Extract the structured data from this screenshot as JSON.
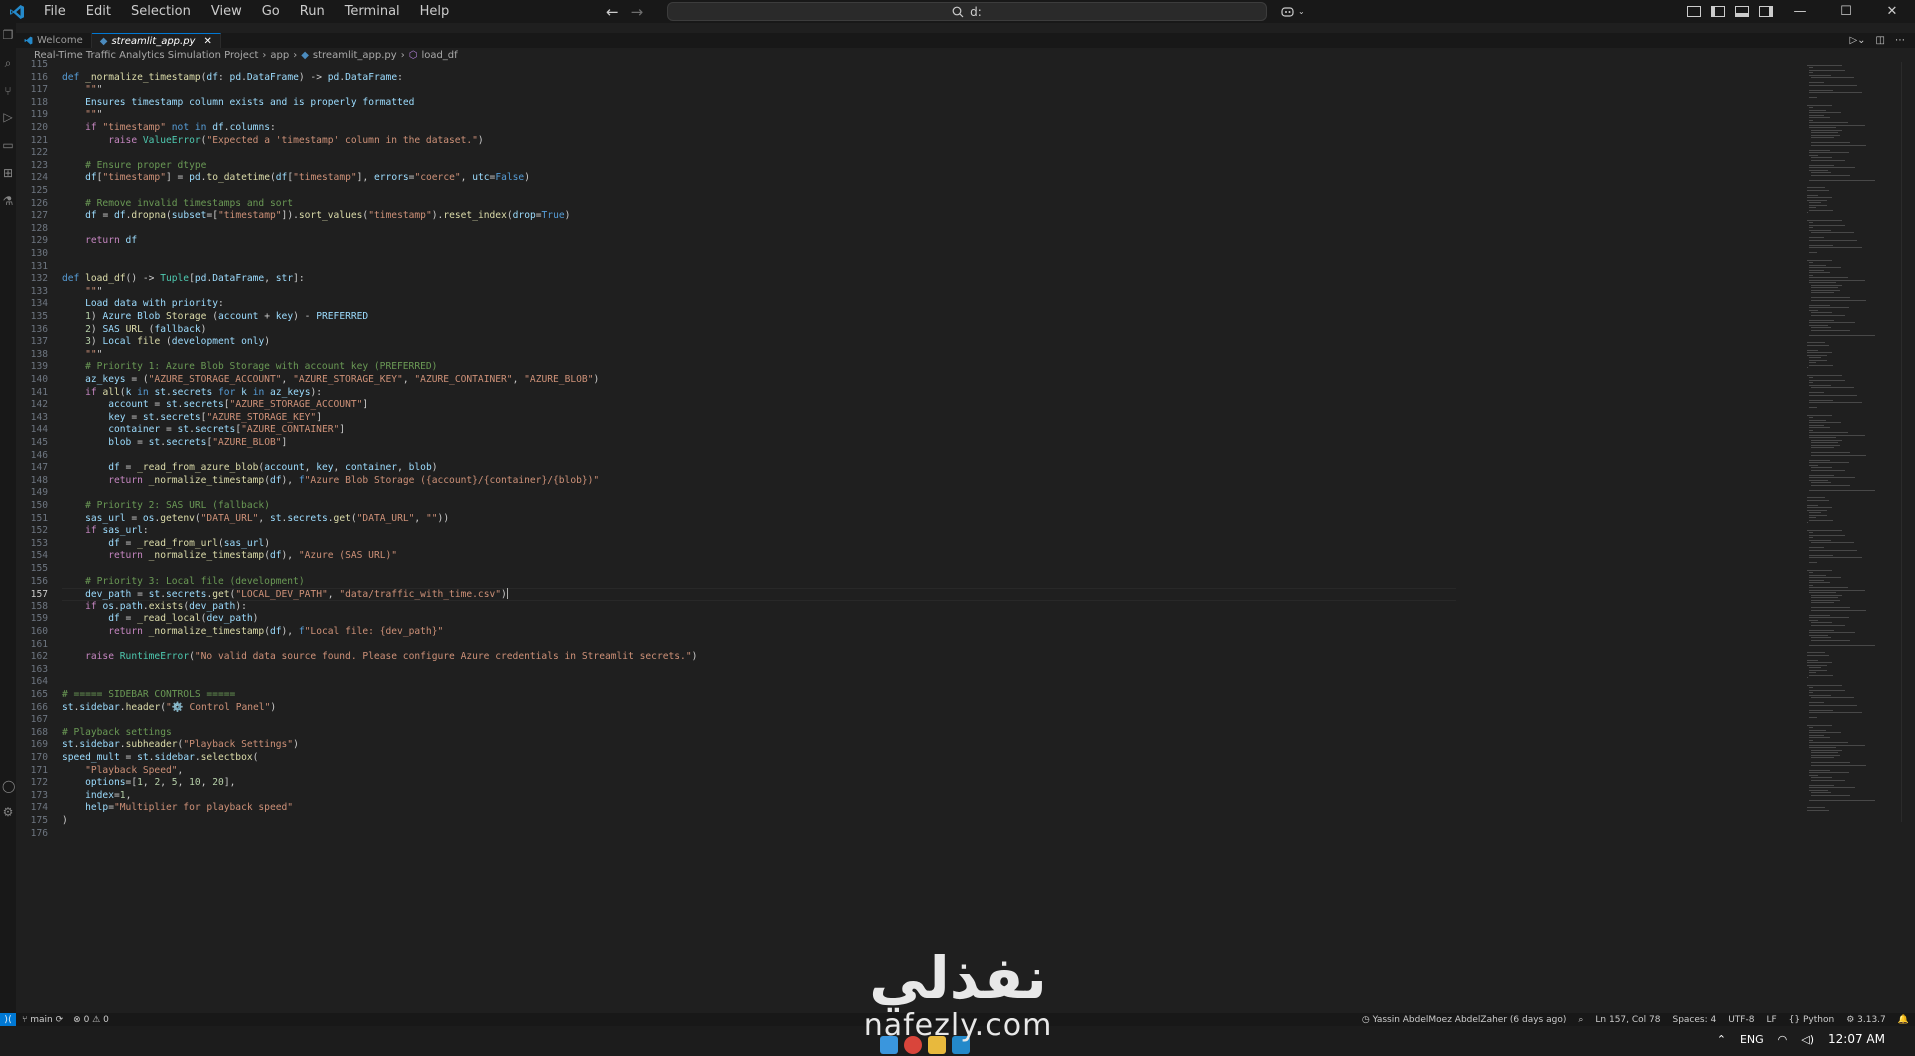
{
  "menu": [
    "File",
    "Edit",
    "Selection",
    "View",
    "Go",
    "Run",
    "Terminal",
    "Help"
  ],
  "command_center": {
    "text": "d:"
  },
  "tabs": [
    {
      "label": "Welcome",
      "active": false
    },
    {
      "label": "streamlit_app.py",
      "active": true
    }
  ],
  "breadcrumb": [
    "Real-Time Traffic Analytics  Simulation Project",
    "app",
    "streamlit_app.py",
    "load_df"
  ],
  "current_line": 157,
  "lines": [
    {
      "n": 115,
      "t": "",
      "i": 0
    },
    {
      "n": 116,
      "t": "def _normalize_timestamp(df: pd.DataFrame) -> pd.DataFrame:",
      "i": 0
    },
    {
      "n": 117,
      "t": "    \"\"\"",
      "i": 1
    },
    {
      "n": 118,
      "t": "    Ensures timestamp column exists and is properly formatted",
      "i": 1
    },
    {
      "n": 119,
      "t": "    \"\"\"",
      "i": 1
    },
    {
      "n": 120,
      "t": "    if \"timestamp\" not in df.columns:",
      "i": 1
    },
    {
      "n": 121,
      "t": "        raise ValueError(\"Expected a 'timestamp' column in the dataset.\")",
      "i": 2
    },
    {
      "n": 122,
      "t": "",
      "i": 0
    },
    {
      "n": 123,
      "t": "    # Ensure proper dtype",
      "i": 1
    },
    {
      "n": 124,
      "t": "    df[\"timestamp\"] = pd.to_datetime(df[\"timestamp\"], errors=\"coerce\", utc=False)",
      "i": 1
    },
    {
      "n": 125,
      "t": "",
      "i": 0
    },
    {
      "n": 126,
      "t": "    # Remove invalid timestamps and sort",
      "i": 1
    },
    {
      "n": 127,
      "t": "    df = df.dropna(subset=[\"timestamp\"]).sort_values(\"timestamp\").reset_index(drop=True)",
      "i": 1
    },
    {
      "n": 128,
      "t": "",
      "i": 0
    },
    {
      "n": 129,
      "t": "    return df",
      "i": 1
    },
    {
      "n": 130,
      "t": "",
      "i": 0
    },
    {
      "n": 131,
      "t": "",
      "i": 0
    },
    {
      "n": 132,
      "t": "def load_df() -> Tuple[pd.DataFrame, str]:",
      "i": 0
    },
    {
      "n": 133,
      "t": "    \"\"\"",
      "i": 1
    },
    {
      "n": 134,
      "t": "    Load data with priority:",
      "i": 1
    },
    {
      "n": 135,
      "t": "    1) Azure Blob Storage (account + key) - PREFERRED",
      "i": 1
    },
    {
      "n": 136,
      "t": "    2) SAS URL (fallback)",
      "i": 1
    },
    {
      "n": 137,
      "t": "    3) Local file (development only)",
      "i": 1
    },
    {
      "n": 138,
      "t": "    \"\"\"",
      "i": 1
    },
    {
      "n": 139,
      "t": "    # Priority 1: Azure Blob Storage with account key (PREFERRED)",
      "i": 1
    },
    {
      "n": 140,
      "t": "    az_keys = (\"AZURE_STORAGE_ACCOUNT\", \"AZURE_STORAGE_KEY\", \"AZURE_CONTAINER\", \"AZURE_BLOB\")",
      "i": 1
    },
    {
      "n": 141,
      "t": "    if all(k in st.secrets for k in az_keys):",
      "i": 1
    },
    {
      "n": 142,
      "t": "        account = st.secrets[\"AZURE_STORAGE_ACCOUNT\"]",
      "i": 2
    },
    {
      "n": 143,
      "t": "        key = st.secrets[\"AZURE_STORAGE_KEY\"]",
      "i": 2
    },
    {
      "n": 144,
      "t": "        container = st.secrets[\"AZURE_CONTAINER\"]",
      "i": 2
    },
    {
      "n": 145,
      "t": "        blob = st.secrets[\"AZURE_BLOB\"]",
      "i": 2
    },
    {
      "n": 146,
      "t": "",
      "i": 0
    },
    {
      "n": 147,
      "t": "        df = _read_from_azure_blob(account, key, container, blob)",
      "i": 2
    },
    {
      "n": 148,
      "t": "        return _normalize_timestamp(df), f\"Azure Blob Storage ({account}/{container}/{blob})\"",
      "i": 2
    },
    {
      "n": 149,
      "t": "",
      "i": 0
    },
    {
      "n": 150,
      "t": "    # Priority 2: SAS URL (fallback)",
      "i": 1
    },
    {
      "n": 151,
      "t": "    sas_url = os.getenv(\"DATA_URL\", st.secrets.get(\"DATA_URL\", \"\"))",
      "i": 1
    },
    {
      "n": 152,
      "t": "    if sas_url:",
      "i": 1
    },
    {
      "n": 153,
      "t": "        df = _read_from_url(sas_url)",
      "i": 2
    },
    {
      "n": 154,
      "t": "        return _normalize_timestamp(df), \"Azure (SAS URL)\"",
      "i": 2
    },
    {
      "n": 155,
      "t": "",
      "i": 0
    },
    {
      "n": 156,
      "t": "    # Priority 3: Local file (development)",
      "i": 1
    },
    {
      "n": 157,
      "t": "    dev_path = st.secrets.get(\"LOCAL_DEV_PATH\", \"data/traffic_with_time.csv\")",
      "i": 1
    },
    {
      "n": 158,
      "t": "    if os.path.exists(dev_path):",
      "i": 1
    },
    {
      "n": 159,
      "t": "        df = _read_local(dev_path)",
      "i": 2
    },
    {
      "n": 160,
      "t": "        return _normalize_timestamp(df), f\"Local file: {dev_path}\"",
      "i": 2
    },
    {
      "n": 161,
      "t": "",
      "i": 0
    },
    {
      "n": 162,
      "t": "    raise RuntimeError(\"No valid data source found. Please configure Azure credentials in Streamlit secrets.\")",
      "i": 1
    },
    {
      "n": 163,
      "t": "",
      "i": 0
    },
    {
      "n": 164,
      "t": "",
      "i": 0
    },
    {
      "n": 165,
      "t": "# ===== SIDEBAR CONTROLS =====",
      "i": 0
    },
    {
      "n": 166,
      "t": "st.sidebar.header(\"⚙️ Control Panel\")",
      "i": 0
    },
    {
      "n": 167,
      "t": "",
      "i": 0
    },
    {
      "n": 168,
      "t": "# Playback settings",
      "i": 0
    },
    {
      "n": 169,
      "t": "st.sidebar.subheader(\"Playback Settings\")",
      "i": 0
    },
    {
      "n": 170,
      "t": "speed_mult = st.sidebar.selectbox(",
      "i": 0
    },
    {
      "n": 171,
      "t": "    \"Playback Speed\",",
      "i": 1
    },
    {
      "n": 172,
      "t": "    options=[1, 2, 5, 10, 20],",
      "i": 1
    },
    {
      "n": 173,
      "t": "    index=1,",
      "i": 1
    },
    {
      "n": 174,
      "t": "    help=\"Multiplier for playback speed\"",
      "i": 1
    },
    {
      "n": 175,
      "t": ")",
      "i": 0
    },
    {
      "n": 176,
      "t": "",
      "i": 0
    }
  ],
  "status": {
    "branch": "main",
    "problems": "0",
    "warnings": "0",
    "blame": "Yassin AbdelMoez AbdelZaher (6 days ago)",
    "position": "Ln 157, Col 78",
    "spaces": "Spaces: 4",
    "encoding": "UTF-8",
    "eol": "LF",
    "language": "Python",
    "version": "3.13.7"
  },
  "tray": {
    "lang": "ENG",
    "time": "12:07 AM"
  },
  "watermark": {
    "arabic": "نفذلي",
    "latin": "nafezly.com"
  },
  "colors": {
    "keyword": "#569cd6",
    "control": "#c586c0",
    "string": "#ce9178",
    "comment": "#6a9955",
    "function": "#dcdcaa",
    "type": "#4ec9b0",
    "variable": "#9cdcfe",
    "number": "#b5cea8",
    "accent": "#0078d4"
  }
}
